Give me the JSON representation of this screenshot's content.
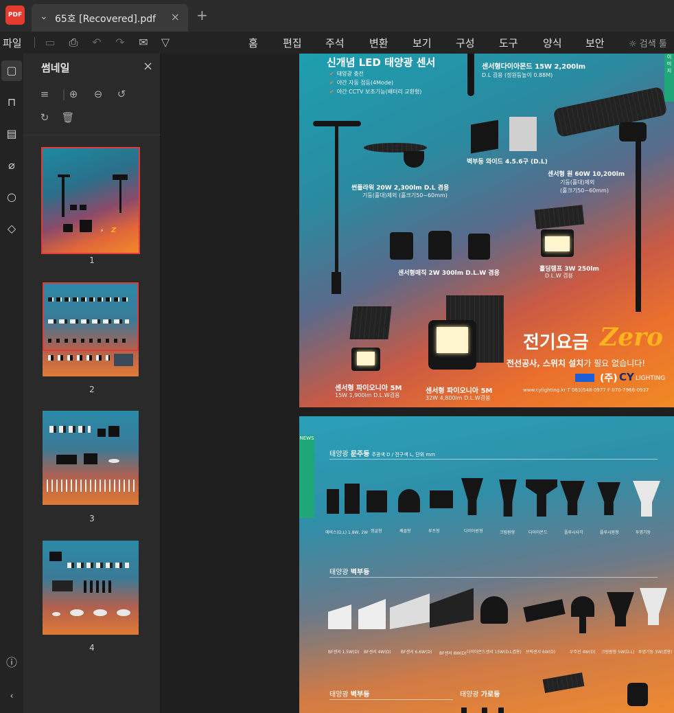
{
  "titlebar": {
    "app_icon_text": "PDF",
    "tab_title": "65호 [Recovered].pdf"
  },
  "toolbar": {
    "file_menu": "파일",
    "menus": [
      "홈",
      "편집",
      "주석",
      "변환",
      "보기",
      "구성",
      "도구",
      "양식",
      "보안"
    ],
    "search_label": "검색 툴"
  },
  "panel": {
    "title": "썸네일",
    "pages": [
      "1",
      "2",
      "3",
      "4"
    ]
  },
  "page1": {
    "headline": "신개념 LED 태양광 센서",
    "bullets": [
      "태양광 충전",
      "야간 자동 점등(4Mode)",
      "야간 CCTV 보조기능(배터리 교환형)"
    ],
    "diamond_title": "센서형다이아몬드 15W 2,200lm",
    "diamond_sub": "D.L 겸용 (정원등높이 0.88M)",
    "wall_title": "벽부등 와이드 4.5.6구 (D.L)",
    "sunflower_title": "썬플라워 20W 2,300lm D.L 겸용",
    "sunflower_sub": "기둥(홀대)제외 (홀크기50~60mm)",
    "sensor_round_title": "센서형 원 60W 10,200lm",
    "sensor_round_sub1": "기둥(홀대)제외",
    "sensor_round_sub2": "(홀크기50~60mm)",
    "magic_title": "센서형매직 2W 300lm D.L.W 겸용",
    "holding_title": "홀딩램프 3W 250lm",
    "holding_sub": "D.L.W 겸용",
    "zero_prefix": "전기요금",
    "zero_word": "Zero",
    "tagline_a": "전선공사, 스위치 설치",
    "tagline_b": "가 필요 없습니다!",
    "brand_paren": "(주)",
    "brand_cy": "CY",
    "brand_lighting": "LIGHTING",
    "pioneer1_title": "센서형 파이오니아 5M",
    "pioneer1_sub": "15W 1,900lm D.L.W겸용",
    "pioneer2_title": "센서형 파이오니아 5M",
    "pioneer2_sub": "32W 4,800lm D.L.W겸용",
    "contact": "www.cylighting.kr   T 063)548-0977   F 070-7966-0937",
    "side_badge": "이 미 지"
  },
  "page2": {
    "news_label": "NEWS",
    "section1_prefix": "태양광",
    "section1_bold": "문주등",
    "section1_note": "주광색 D / 전구색 L, 단위 mm",
    "section2_prefix": "태양광",
    "section2_bold": "벽부등",
    "section3_prefix": "태양광",
    "section3_bold": "벽부등",
    "section4_prefix": "태양광",
    "section4_bold": "가로등",
    "row1_labels": [
      "에비스(D,L) 1.8W, 2W",
      "정글형",
      "쌔클형",
      "루프형",
      "다이아원형",
      "크림원형",
      "다이아몬드",
      "플루시사각",
      "플루시원형",
      "투명기둥"
    ],
    "row2_labels": [
      "BF센서 1.5W(D)",
      "BF센서 4W(D)",
      "BF센서 6.6W(D)",
      "BF센서 8W(D)",
      "다이아몬드센서 15W(D.L겸용)",
      "브릭센서 6W(D)",
      "우주선 4W(D)",
      "크림원형 5W(D.L)",
      "투명기둥 3W(겸용)"
    ]
  }
}
